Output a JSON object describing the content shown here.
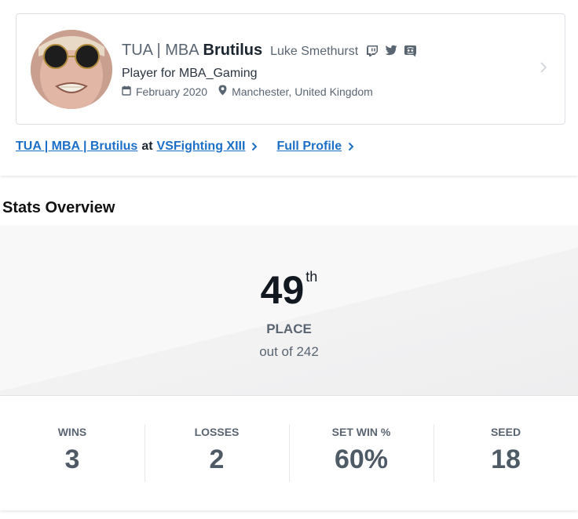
{
  "profile": {
    "prefix": "TUA | MBA",
    "gamertag": "Brutilus",
    "real_name": "Luke Smethurst",
    "team": "Player for MBA_Gaming",
    "joined": "February 2020",
    "location": "Manchester, United Kingdom",
    "social_icons": [
      "twitch-icon",
      "twitter-icon",
      "discord-icon"
    ]
  },
  "links": {
    "entrant_link": "TUA | MBA | Brutilus",
    "at_text": "at",
    "event_link": "VSFighting XIII",
    "full_profile": "Full Profile"
  },
  "stats": {
    "title": "Stats Overview",
    "place_number": "49",
    "place_suffix": "th",
    "place_label": "PLACE",
    "place_of": "out of 242",
    "items": [
      {
        "label": "WINS",
        "value": "3"
      },
      {
        "label": "LOSSES",
        "value": "2"
      },
      {
        "label": "SET WIN %",
        "value": "60%"
      },
      {
        "label": "SEED",
        "value": "18"
      }
    ]
  },
  "colors": {
    "link": "#1c6fc7",
    "muted": "#5a6572",
    "dark": "#111820"
  }
}
